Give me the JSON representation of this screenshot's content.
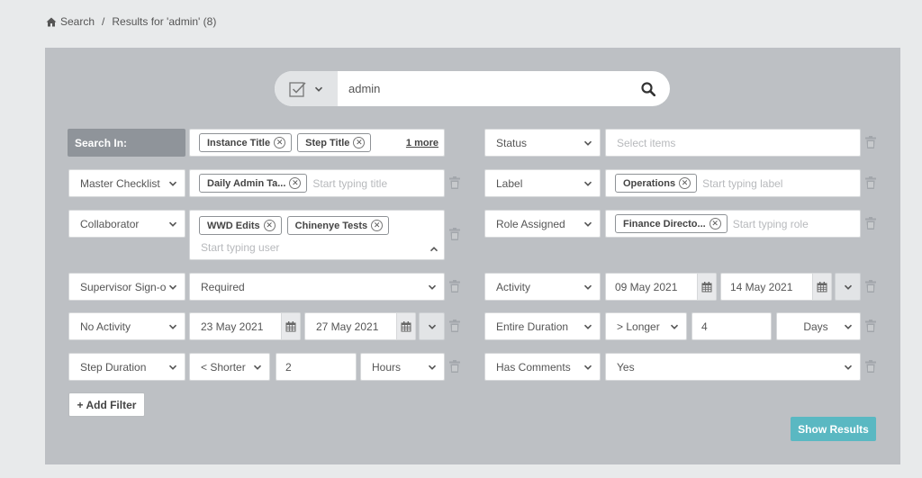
{
  "breadcrumb": {
    "home": "Search",
    "separator": "/",
    "current": "Results for 'admin' (8)"
  },
  "search": {
    "query": "admin"
  },
  "search_in": {
    "label": "Search In:",
    "tags": [
      "Instance Title",
      "Step Title"
    ],
    "more": "1 more"
  },
  "filters": {
    "master_checklist": {
      "field": "Master Checklist",
      "tags": [
        "Daily Admin Ta..."
      ],
      "placeholder": "Start typing title"
    },
    "collaborator": {
      "field": "Collaborator",
      "tags": [
        "WWD Edits",
        "Chinenye Tests"
      ],
      "placeholder": "Start typing user"
    },
    "supervisor": {
      "field": "Supervisor Sign-o",
      "value": "Required"
    },
    "no_activity": {
      "field": "No Activity",
      "from": "23 May 2021",
      "to": "27 May 2021"
    },
    "step_duration": {
      "field": "Step Duration",
      "operator": "< Shorter",
      "amount": "2",
      "unit": "Hours"
    },
    "status": {
      "field": "Status",
      "placeholder": "Select items"
    },
    "label": {
      "field": "Label",
      "tags": [
        "Operations"
      ],
      "placeholder": "Start typing label"
    },
    "role": {
      "field": "Role Assigned",
      "tags": [
        "Finance Directo..."
      ],
      "placeholder": "Start typing role"
    },
    "activity": {
      "field": "Activity",
      "from": "09 May 2021",
      "to": "14 May 2021"
    },
    "entire_duration": {
      "field": "Entire Duration",
      "operator": "> Longer",
      "amount": "4",
      "unit": "Days"
    },
    "has_comments": {
      "field": "Has Comments",
      "value": "Yes"
    }
  },
  "buttons": {
    "add_filter": "+ Add Filter",
    "show_results": "Show Results"
  },
  "colors": {
    "accent": "#5ab8c2",
    "panel": "#bdc0c4",
    "label_bg": "#8f949a"
  },
  "icons": {
    "home": "home-icon",
    "checkbox": "checkbox-icon",
    "search": "search-icon",
    "trash": "trash-icon",
    "calendar": "calendar-icon",
    "chevron": "chevron-down-icon",
    "close": "close-icon"
  }
}
